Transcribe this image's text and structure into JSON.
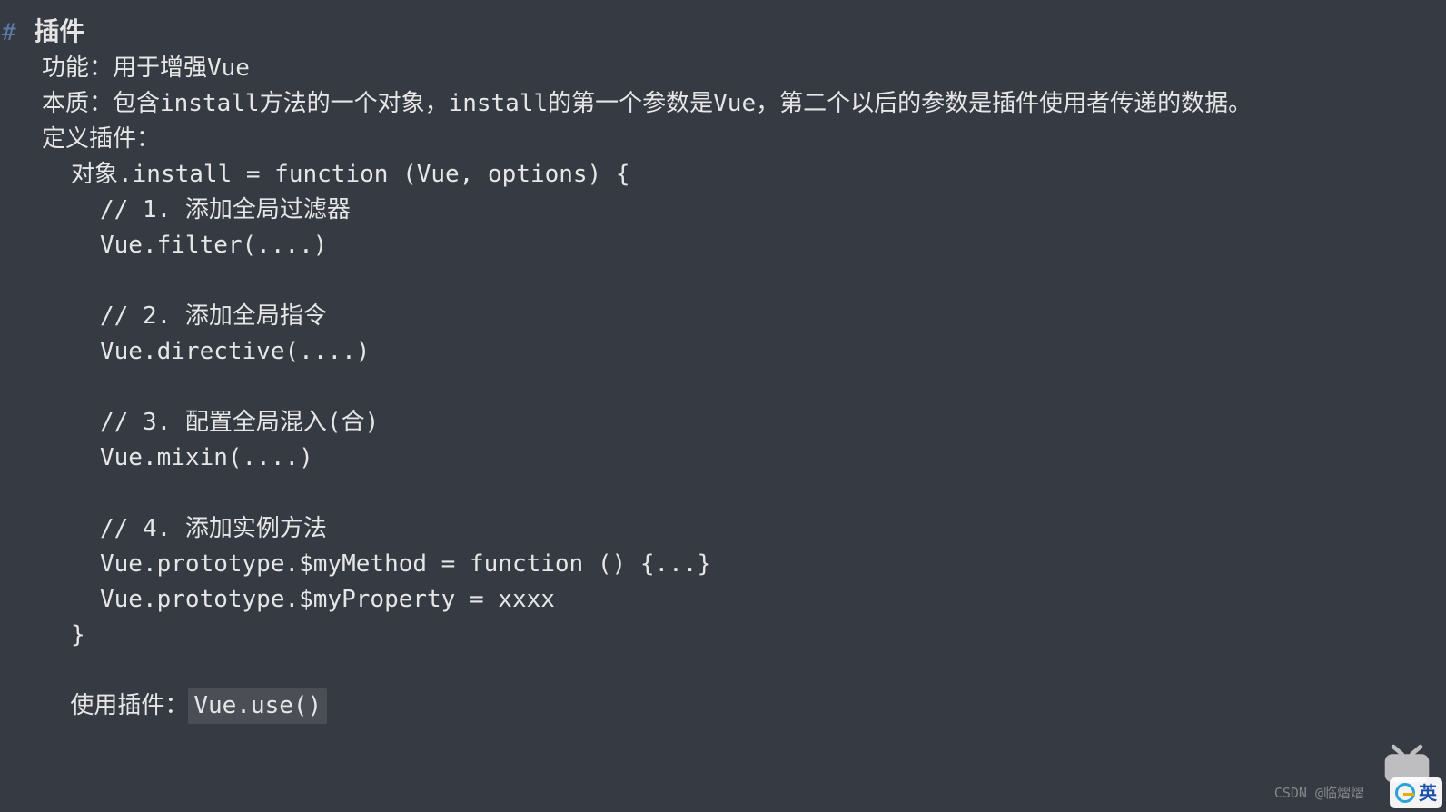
{
  "markdown_hash": "#",
  "heading": "插件",
  "line_func": "功能：用于增强Vue",
  "line_essence": "本质：包含install方法的一个对象，install的第一个参数是Vue，第二个以后的参数是插件使用者传递的数据。",
  "line_define": "定义插件：",
  "line_sig": "对象.install = function (Vue, options) {",
  "code": {
    "c1": "// 1. 添加全局过滤器",
    "l1": "Vue.filter(....)",
    "c2": "// 2. 添加全局指令",
    "l2": "Vue.directive(....)",
    "c3": "// 3. 配置全局混入(合)",
    "l3": "Vue.mixin(....)",
    "c4": "// 4. 添加实例方法",
    "l4a": "Vue.prototype.$myMethod = function () {...}",
    "l4b": "Vue.prototype.$myProperty = xxxx",
    "close": "}"
  },
  "line_use_prefix": "使用插件：",
  "line_use_code": "Vue.use()",
  "watermark": "CSDN @临熠熠",
  "logo_text": "英"
}
